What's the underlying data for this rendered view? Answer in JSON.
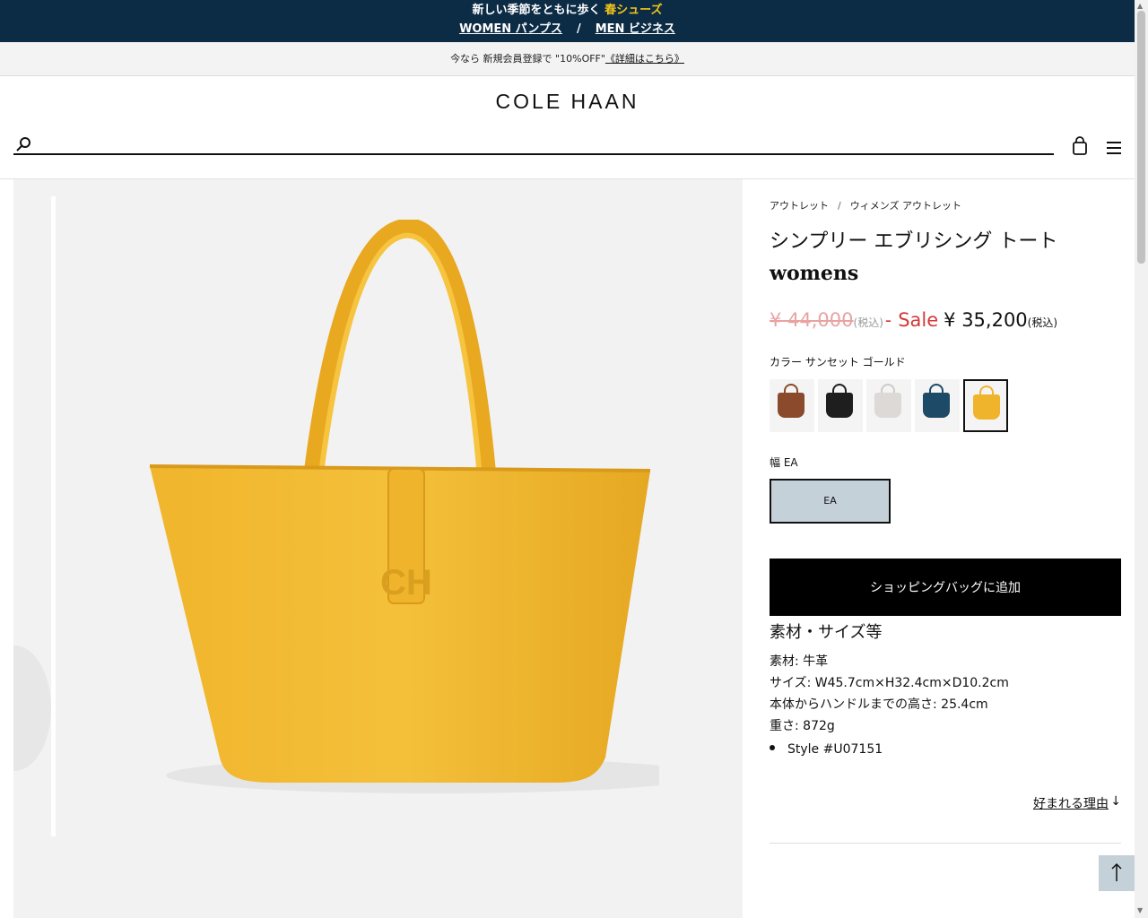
{
  "promo": {
    "line1_prefix": "新しい季節をともに歩く",
    "line1_highlight": "春シューズ",
    "women_link": "WOMEN パンプス",
    "separator": "/",
    "men_link": "MEN ビジネス"
  },
  "member_banner": {
    "text": "今なら 新規会員登録で \"10%OFF\"",
    "link": "《詳細はこちら》"
  },
  "header": {
    "logo": "COLE HAAN",
    "search_placeholder": ""
  },
  "breadcrumb": {
    "items": [
      "アウトレット",
      "ウィメンズ アウトレット"
    ],
    "separator": "/"
  },
  "product": {
    "title": "シンプリー エブリシング トート",
    "subtitle": "womens",
    "original_price": "¥ 44,000",
    "tax_note": "(税込)",
    "dash": "-",
    "sale_label": "Sale",
    "sale_price": "¥ 35,200",
    "tax_note2": "(税込)",
    "color_label": "カラー サンセット ゴールド",
    "swatches": [
      {
        "color": "#8a4a2b"
      },
      {
        "color": "#1e1e1e"
      },
      {
        "color": "#ddd9d6"
      },
      {
        "color": "#1d4a66"
      },
      {
        "color": "#f0b42c"
      }
    ],
    "width_label": "幅 EA",
    "width_option": "EA",
    "add_to_bag": "ショッピングバッグに追加",
    "spec_heading": "素材・サイズ等",
    "specs": [
      "素材: 牛革",
      "サイズ: W45.7cm×H32.4cm×D10.2cm",
      "本体からハンドルまでの高さ: 25.4cm",
      "重さ: 872g"
    ],
    "style": "Style #U07151",
    "reason_link": "好まれる理由",
    "reason_arrow": "↓"
  },
  "colors": {
    "promo_bg": "#0c2b45",
    "highlight": "#f2c518",
    "sale_red": "#d43a3a",
    "bag_yellow": "#f0b42c"
  }
}
